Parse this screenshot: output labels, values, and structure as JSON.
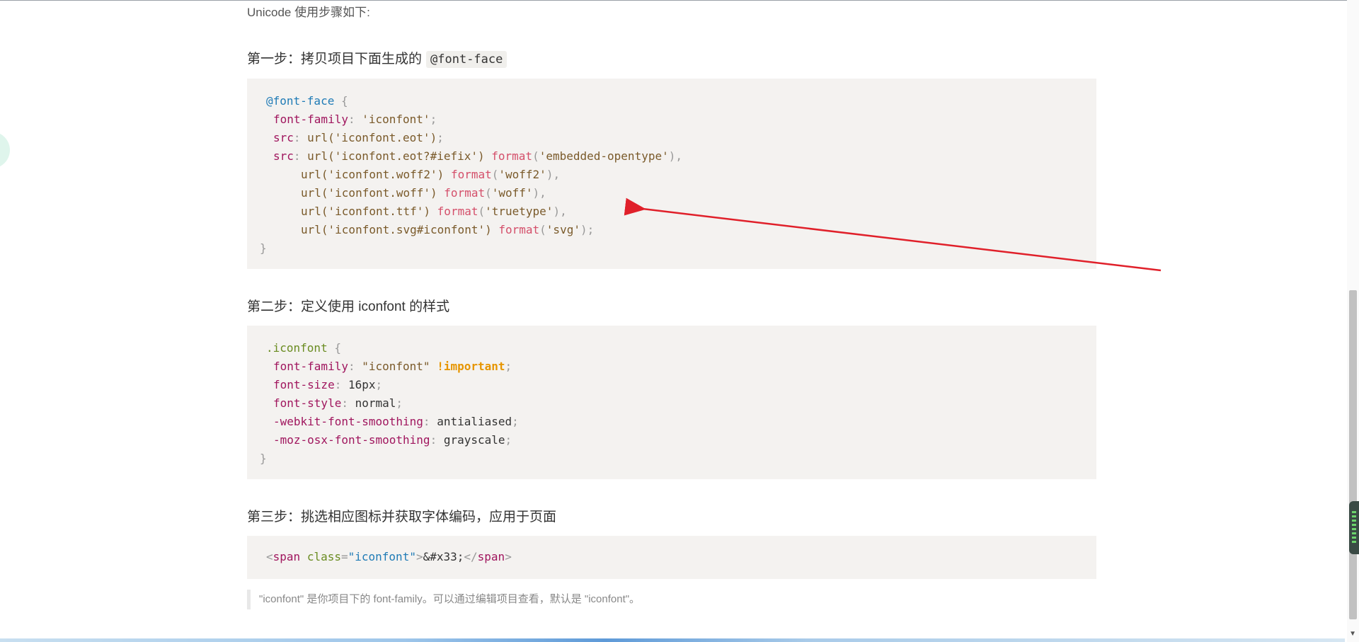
{
  "intro": "Unicode 使用步骤如下:",
  "step1": {
    "label": "第一步：拷贝项目下面生成的",
    "code": "@font-face"
  },
  "step2": {
    "label": "第二步：定义使用 iconfont 的样式"
  },
  "step3": {
    "label": "第三步：挑选相应图标并获取字体编码，应用于页面"
  },
  "code1": {
    "line1_sel": "@font-face",
    "line1_brace": " {",
    "line2_prop": "font-family",
    "line2_val": "'iconfont'",
    "line3_prop": "src",
    "line3_fn": "url(",
    "line3_val": "'iconfont.eot'",
    "line4_prop": "src",
    "line4_url": "url('iconfont.eot?#iefix')",
    "line4_fmt": "format",
    "line4_arg": "'embedded-opentype'",
    "line5_url": "url('iconfont.woff2')",
    "line5_arg": "'woff2'",
    "line6_url": "url('iconfont.woff')",
    "line6_arg": "'woff'",
    "line7_url": "url('iconfont.ttf')",
    "line7_arg": "'truetype'",
    "line8_url": "url('iconfont.svg#iconfont')",
    "line8_arg": "'svg'",
    "format_kw": "format",
    "close_brace": "}"
  },
  "code2": {
    "sel": ".iconfont",
    "p1": "font-family",
    "v1": "\"iconfont\"",
    "imp": "!important",
    "p2": "font-size",
    "v2": "16px",
    "p3": "font-style",
    "v3": "normal",
    "p4": "-webkit-font-smoothing",
    "v4": "antialiased",
    "p5": "-moz-osx-font-smoothing",
    "v5": "grayscale",
    "close": "}"
  },
  "code3": {
    "lt": "<",
    "tag": "span",
    "attr": "class",
    "eq": "=",
    "attrv": "\"iconfont\"",
    "gt": ">",
    "entity": "&#x33;",
    "endtag_open": "</",
    "endtag": "span",
    "endtag_close": ">"
  },
  "note": "\"iconfont\" 是你项目下的 font-family。可以通过编辑项目查看，默认是 \"iconfont\"。",
  "colors": {
    "code_bg": "#f4f2f0",
    "arrow": "#e0202a",
    "selector": "#1f7bb6",
    "property": "#a0165e",
    "important": "#e69500"
  }
}
